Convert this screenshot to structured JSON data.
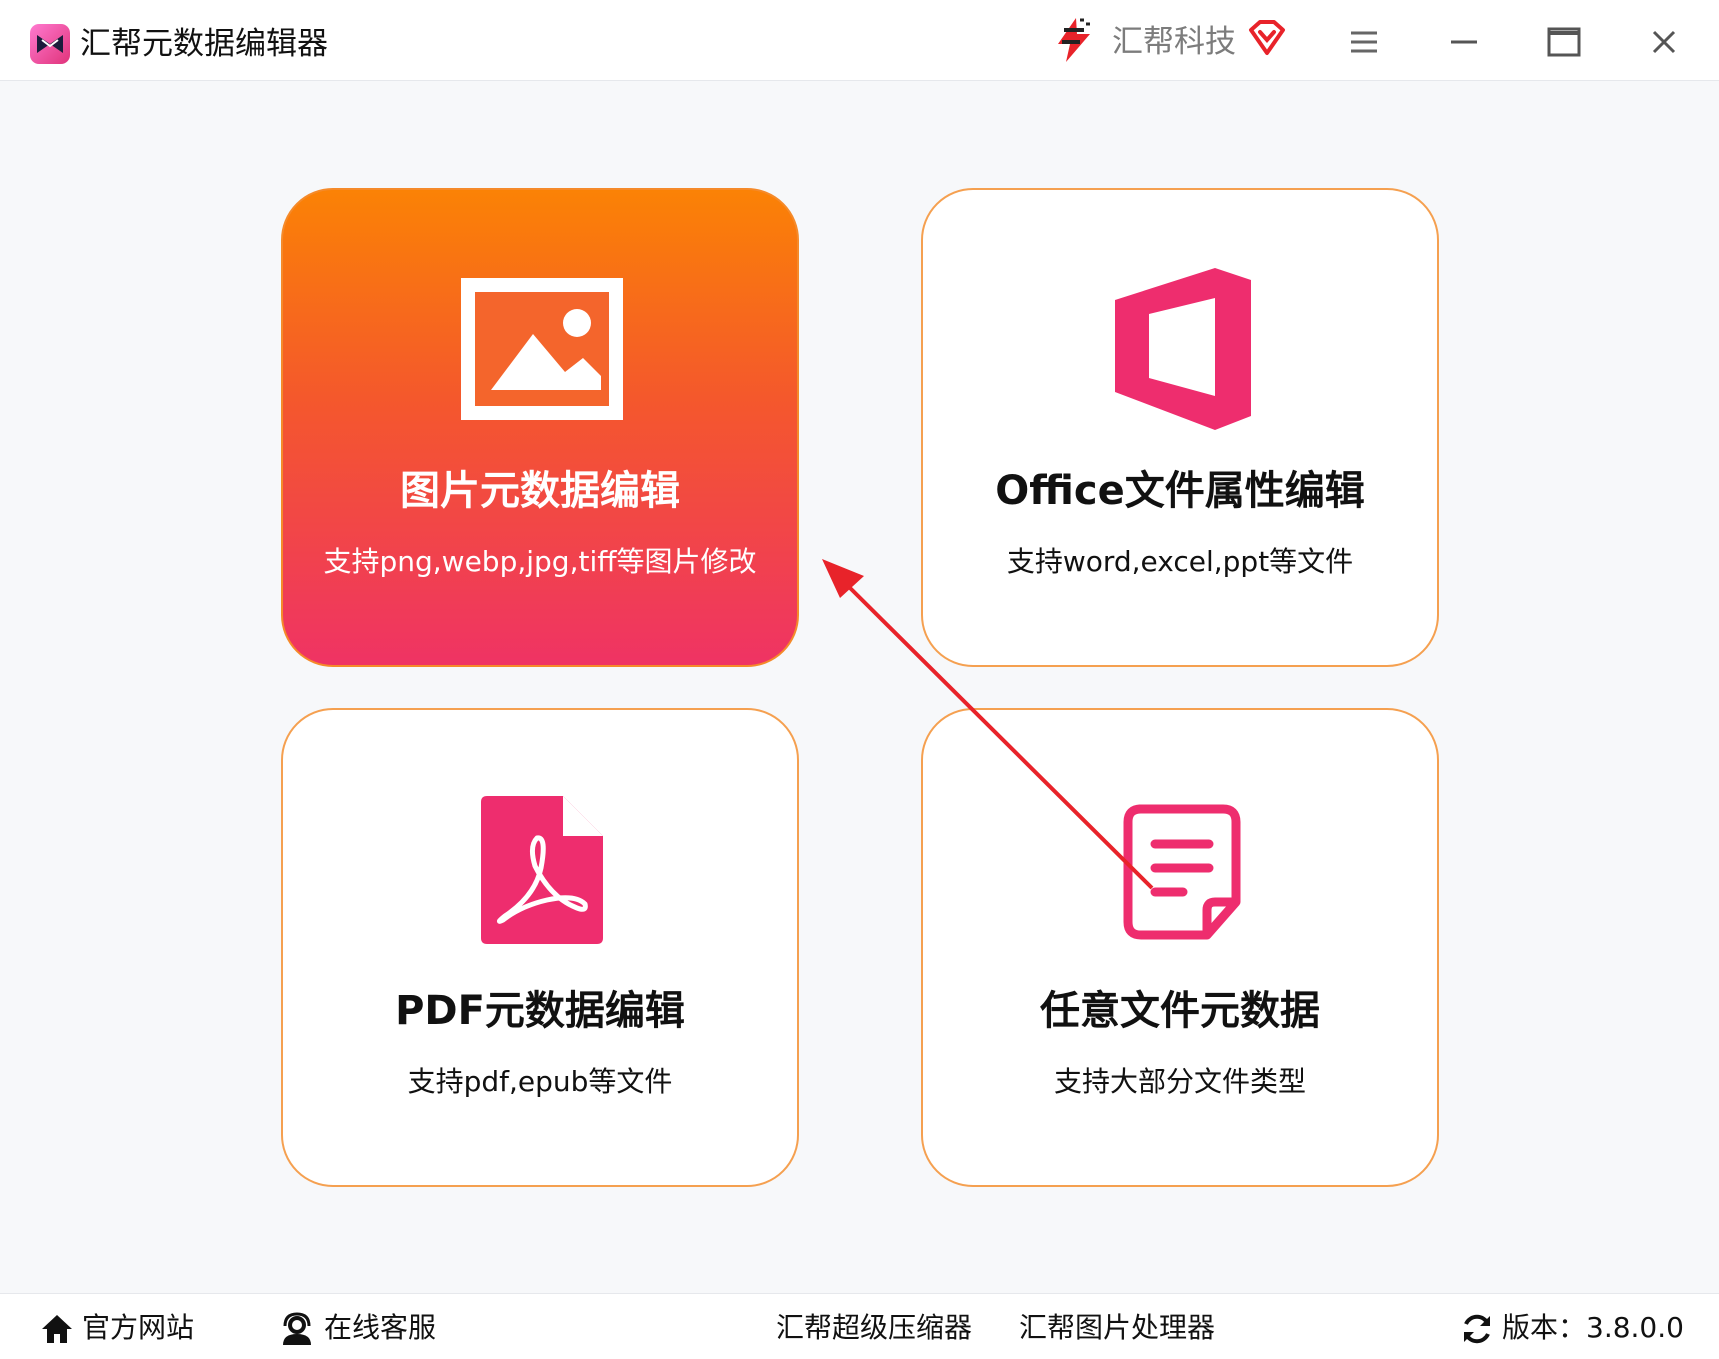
{
  "window": {
    "title": "汇帮元数据编辑器",
    "brand_name": "汇帮科技"
  },
  "cards": [
    {
      "title": "图片元数据编辑",
      "subtitle": "支持png,webp,jpg,tiff等图片修改"
    },
    {
      "title": "Office文件属性编辑",
      "subtitle": "支持word,excel,ppt等文件"
    },
    {
      "title": "PDF元数据编辑",
      "subtitle": "支持pdf,epub等文件"
    },
    {
      "title": "任意文件元数据",
      "subtitle": "支持大部分文件类型"
    }
  ],
  "footer": {
    "website": "官方网站",
    "service": "在线客服",
    "compressor": "汇帮超级压缩器",
    "photo_processor": "汇帮图片处理器",
    "version": "版本：3.8.0.0"
  },
  "colors": {
    "accent_orange": "#fb8205",
    "accent_pink": "#ef3364",
    "icon_pink": "#ee2d6e",
    "card_border": "#f5a050"
  }
}
